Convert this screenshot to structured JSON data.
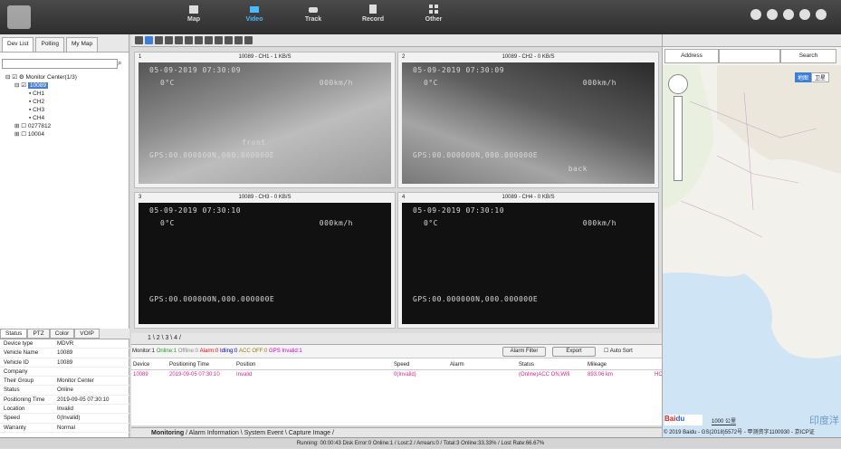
{
  "nav": {
    "items": [
      "Map",
      "Video",
      "Track",
      "Record",
      "Other"
    ],
    "active": "Video"
  },
  "left": {
    "tabs": [
      "Dev List",
      "Polling",
      "My Map"
    ],
    "tree": {
      "root": "Monitor Center(1/3)",
      "device": "10089",
      "channels": [
        "CH1",
        "CH2",
        "CH3",
        "CH4"
      ],
      "others": [
        "0277812",
        "10004"
      ]
    },
    "info_tabs": [
      "Status",
      "PTZ",
      "Color",
      "VOIP"
    ],
    "info": [
      {
        "k": "Device type",
        "v": "MDVR"
      },
      {
        "k": "Vehicle Name",
        "v": "10089"
      },
      {
        "k": "Vehicle ID",
        "v": "10089"
      },
      {
        "k": "Company",
        "v": ""
      },
      {
        "k": "Their Group",
        "v": "Monitor Center"
      },
      {
        "k": "Status",
        "v": "Online"
      },
      {
        "k": "Positioning Time",
        "v": "2019-09-05 07:30:10"
      },
      {
        "k": "Location",
        "v": "Invalid"
      },
      {
        "k": "Speed",
        "v": "0(Invalid)"
      },
      {
        "k": "Warranty",
        "v": "Normal"
      }
    ]
  },
  "video": {
    "cells": [
      {
        "n": "1",
        "title": "10089 - CH1 - 1 KB/S",
        "ts": "05-09-2019 07:30:09",
        "temp": "0°C",
        "spd": "000km/h",
        "label": "front",
        "gps": "GPS:00.000000N,000.000000E"
      },
      {
        "n": "2",
        "title": "10089 - CH2 - 0 KB/S",
        "ts": "05-09-2019 07:30:09",
        "temp": "0°C",
        "spd": "000km/h",
        "label": "back",
        "gps": "GPS:00.000000N,000.000000E"
      },
      {
        "n": "3",
        "title": "10089 - CH3 - 0 KB/S",
        "ts": "05-09-2019 07:30:10",
        "temp": "0°C",
        "spd": "000km/h",
        "label": "",
        "gps": "GPS:00.000000N,000.000000E"
      },
      {
        "n": "4",
        "title": "10089 - CH4 - 0 KB/S",
        "ts": "05-09-2019 07:30:10",
        "temp": "0°C",
        "spd": "000km/h",
        "label": "",
        "gps": "GPS:00.000000N,000.000000E"
      }
    ],
    "pages": "1 \\ 2 \\ 3 \\ 4 /"
  },
  "grid": {
    "summary": {
      "monitor": "Monitor:1",
      "online": "Online:1",
      "offline": "Offline:0",
      "alarm": "Alarm:0",
      "idling": "Idling:0",
      "acc": "ACC OFF:0",
      "gps": "GPS Invalid:1"
    },
    "buttons": {
      "filter": "Alarm Filter",
      "export": "Export",
      "autosort": "Auto Sort"
    },
    "headers": [
      "Device",
      "Positioning Time",
      "Position",
      "Speed",
      "Alarm",
      "Status",
      "Mileage",
      ""
    ],
    "rows": [
      [
        "10089",
        "2019-09-05 07:30:10",
        "Invalid",
        "0(Invalid)",
        "",
        "(Online)ACC ON,Wifi",
        "893.06 km",
        "HC"
      ]
    ]
  },
  "bottom_tabs": [
    "Monitoring",
    "Alarm Information",
    "System Event",
    "Capture Image"
  ],
  "map": {
    "address": "Address",
    "search": "Search",
    "map_btn": "地图",
    "sat_btn": "卫星",
    "scale": "1000 公里",
    "copyright": "© 2019 Baidu - GS(2018)5572号 - 甲测资字1100930 - 京ICP证",
    "ocean": "印度洋"
  },
  "status_text": "Running: 00:00:43   Disk Error:0   Online:1 / Lost:2 / Arrears:0 / Total:3   Online:33.33% / Lost Rate:66.67%"
}
